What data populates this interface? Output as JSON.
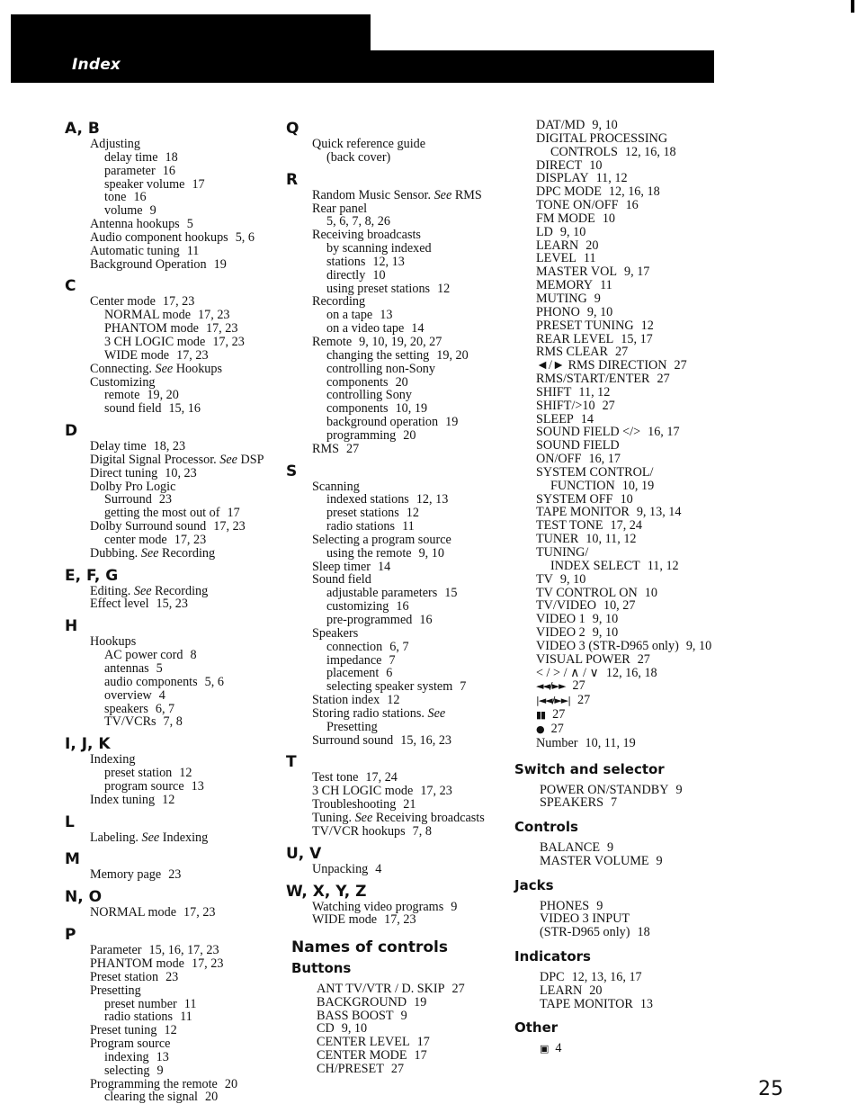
{
  "header": {
    "title": "Index"
  },
  "page_number": "25",
  "column1": [
    {
      "letter": "A, B",
      "entries": [
        {
          "level": 0,
          "text": "Adjusting",
          "pages": ""
        },
        {
          "level": 1,
          "text": "delay time",
          "pages": "18"
        },
        {
          "level": 1,
          "text": "parameter",
          "pages": "16"
        },
        {
          "level": 1,
          "text": "speaker volume",
          "pages": "17"
        },
        {
          "level": 1,
          "text": "tone",
          "pages": "16"
        },
        {
          "level": 1,
          "text": "volume",
          "pages": "9"
        },
        {
          "level": 0,
          "text": "Antenna hookups",
          "pages": "5"
        },
        {
          "level": 0,
          "text": "Audio component hookups",
          "pages": "5, 6"
        },
        {
          "level": 0,
          "text": "Automatic tuning",
          "pages": "11"
        },
        {
          "level": 0,
          "text": "Background Operation",
          "pages": "19"
        }
      ]
    },
    {
      "letter": "C",
      "entries": [
        {
          "level": 0,
          "text": "Center mode",
          "pages": "17, 23"
        },
        {
          "level": 1,
          "text": "NORMAL mode",
          "pages": "17, 23"
        },
        {
          "level": 1,
          "text": "PHANTOM mode",
          "pages": "17, 23"
        },
        {
          "level": 1,
          "text": "3 CH LOGIC mode",
          "pages": "17, 23"
        },
        {
          "level": 1,
          "text": "WIDE mode",
          "pages": "17, 23"
        },
        {
          "level": 0,
          "text": "Connecting.",
          "see": "See",
          "after": "Hookups",
          "pages": ""
        },
        {
          "level": 0,
          "text": "Customizing",
          "pages": ""
        },
        {
          "level": 1,
          "text": "remote",
          "pages": "19, 20"
        },
        {
          "level": 1,
          "text": "sound field",
          "pages": "15, 16"
        }
      ]
    },
    {
      "letter": "D",
      "entries": [
        {
          "level": 0,
          "text": "Delay time",
          "pages": "18, 23"
        },
        {
          "level": 0,
          "text": "Digital Signal Processor.",
          "see": "See",
          "after": "DSP",
          "pages": ""
        },
        {
          "level": 0,
          "text": "Direct tuning",
          "pages": "10, 23"
        },
        {
          "level": 0,
          "text": "Dolby Pro Logic",
          "pages": ""
        },
        {
          "level": 1,
          "text": "Surround",
          "pages": "23"
        },
        {
          "level": 1,
          "text": "getting the most out of",
          "pages": "17"
        },
        {
          "level": 0,
          "text": "Dolby Surround sound",
          "pages": "17, 23"
        },
        {
          "level": 1,
          "text": "center mode",
          "pages": "17, 23"
        },
        {
          "level": 0,
          "text": "Dubbing.",
          "see": "See",
          "after": "Recording",
          "pages": ""
        }
      ]
    },
    {
      "letter": "E, F, G",
      "entries": [
        {
          "level": 0,
          "text": "Editing.",
          "see": "See",
          "after": "Recording",
          "pages": ""
        },
        {
          "level": 0,
          "text": "Effect level",
          "pages": "15, 23"
        }
      ]
    },
    {
      "letter": "H",
      "entries": [
        {
          "level": 0,
          "text": "Hookups",
          "pages": ""
        },
        {
          "level": 1,
          "text": "AC power cord",
          "pages": "8"
        },
        {
          "level": 1,
          "text": "antennas",
          "pages": "5"
        },
        {
          "level": 1,
          "text": "audio components",
          "pages": "5, 6"
        },
        {
          "level": 1,
          "text": "overview",
          "pages": "4"
        },
        {
          "level": 1,
          "text": "speakers",
          "pages": "6, 7"
        },
        {
          "level": 1,
          "text": "TV/VCRs",
          "pages": "7, 8"
        }
      ]
    },
    {
      "letter": "I, J, K",
      "entries": [
        {
          "level": 0,
          "text": "Indexing",
          "pages": ""
        },
        {
          "level": 1,
          "text": "preset station",
          "pages": "12"
        },
        {
          "level": 1,
          "text": "program source",
          "pages": "13"
        },
        {
          "level": 0,
          "text": "Index tuning",
          "pages": "12"
        }
      ]
    },
    {
      "letter": "L",
      "entries": [
        {
          "level": 0,
          "text": "Labeling.",
          "see": "See",
          "after": "Indexing",
          "pages": ""
        }
      ]
    },
    {
      "letter": "M",
      "entries": [
        {
          "level": 0,
          "text": "Memory page",
          "pages": "23"
        }
      ]
    },
    {
      "letter": "N, O",
      "entries": [
        {
          "level": 0,
          "text": "NORMAL mode",
          "pages": "17, 23"
        }
      ]
    },
    {
      "letter": "P",
      "entries": [
        {
          "level": 0,
          "text": "Parameter",
          "pages": "15, 16, 17, 23"
        },
        {
          "level": 0,
          "text": "PHANTOM mode",
          "pages": "17, 23"
        },
        {
          "level": 0,
          "text": "Preset station",
          "pages": "23"
        },
        {
          "level": 0,
          "text": "Presetting",
          "pages": ""
        },
        {
          "level": 1,
          "text": "preset number",
          "pages": "11"
        },
        {
          "level": 1,
          "text": "radio stations",
          "pages": "11"
        },
        {
          "level": 0,
          "text": "Preset tuning",
          "pages": "12"
        },
        {
          "level": 0,
          "text": "Program source",
          "pages": ""
        },
        {
          "level": 1,
          "text": "indexing",
          "pages": "13"
        },
        {
          "level": 1,
          "text": "selecting",
          "pages": "9"
        },
        {
          "level": 0,
          "text": "Programming the remote",
          "pages": "20"
        },
        {
          "level": 1,
          "text": "clearing the signal",
          "pages": "20"
        }
      ]
    }
  ],
  "column2": [
    {
      "letter": "Q",
      "entries": [
        {
          "level": 0,
          "text": "Quick reference guide",
          "pages": ""
        },
        {
          "level": 1,
          "text": "(back cover)",
          "pages": ""
        }
      ]
    },
    {
      "letter": "R",
      "entries": [
        {
          "level": 0,
          "text": "Random Music Sensor.",
          "see": "See",
          "after": "RMS",
          "pages": ""
        },
        {
          "level": 0,
          "text": "Rear panel",
          "pages": ""
        },
        {
          "level": 1,
          "text": "5, 6, 7, 8, 26",
          "pages": ""
        },
        {
          "level": 0,
          "text": "Receiving broadcasts",
          "pages": ""
        },
        {
          "level": 1,
          "text": "by scanning indexed",
          "pages": ""
        },
        {
          "level": 1,
          "text": "stations",
          "pages": "12, 13"
        },
        {
          "level": 1,
          "text": "directly",
          "pages": "10"
        },
        {
          "level": 1,
          "text": "using preset stations",
          "pages": "12"
        },
        {
          "level": 0,
          "text": "Recording",
          "pages": ""
        },
        {
          "level": 1,
          "text": "on a tape",
          "pages": "13"
        },
        {
          "level": 1,
          "text": "on a video tape",
          "pages": "14"
        },
        {
          "level": 0,
          "text": "Remote",
          "pages": "9, 10, 19, 20, 27"
        },
        {
          "level": 1,
          "text": "changing the setting",
          "pages": "19, 20"
        },
        {
          "level": 1,
          "text": "controlling non-Sony",
          "pages": ""
        },
        {
          "level": 1,
          "text": "components",
          "pages": "20"
        },
        {
          "level": 1,
          "text": "controlling Sony",
          "pages": ""
        },
        {
          "level": 1,
          "text": "components",
          "pages": "10, 19"
        },
        {
          "level": 1,
          "text": "background operation",
          "pages": "19"
        },
        {
          "level": 1,
          "text": "programming",
          "pages": "20"
        },
        {
          "level": 0,
          "text": "RMS",
          "pages": "27"
        }
      ]
    },
    {
      "letter": "S",
      "entries": [
        {
          "level": 0,
          "text": "Scanning",
          "pages": ""
        },
        {
          "level": 1,
          "text": "indexed stations",
          "pages": "12, 13"
        },
        {
          "level": 1,
          "text": "preset stations",
          "pages": "12"
        },
        {
          "level": 1,
          "text": "radio stations",
          "pages": "11"
        },
        {
          "level": 0,
          "text": "Selecting a program source",
          "pages": ""
        },
        {
          "level": 1,
          "text": "using the remote",
          "pages": "9, 10"
        },
        {
          "level": 0,
          "text": "Sleep timer",
          "pages": "14"
        },
        {
          "level": 0,
          "text": "Sound field",
          "pages": ""
        },
        {
          "level": 1,
          "text": "adjustable parameters",
          "pages": "15"
        },
        {
          "level": 1,
          "text": "customizing",
          "pages": "16"
        },
        {
          "level": 1,
          "text": "pre-programmed",
          "pages": "16"
        },
        {
          "level": 0,
          "text": "Speakers",
          "pages": ""
        },
        {
          "level": 1,
          "text": "connection",
          "pages": "6, 7"
        },
        {
          "level": 1,
          "text": "impedance",
          "pages": "7"
        },
        {
          "level": 1,
          "text": "placement",
          "pages": "6"
        },
        {
          "level": 1,
          "text": "selecting speaker system",
          "pages": "7"
        },
        {
          "level": 0,
          "text": "Station index",
          "pages": "12"
        },
        {
          "level": 0,
          "text": "Storing radio stations.",
          "see": "See",
          "after": "",
          "pages": ""
        },
        {
          "level": 1,
          "text": "Presetting",
          "pages": ""
        },
        {
          "level": 0,
          "text": "Surround sound",
          "pages": "15, 16, 23"
        }
      ]
    },
    {
      "letter": "T",
      "entries": [
        {
          "level": 0,
          "text": "Test tone",
          "pages": "17, 24"
        },
        {
          "level": 0,
          "text": "3 CH LOGIC mode",
          "pages": "17, 23"
        },
        {
          "level": 0,
          "text": "Troubleshooting",
          "pages": "21"
        },
        {
          "level": 0,
          "text": "Tuning.",
          "see": "See",
          "after": "Receiving broadcasts",
          "pages": ""
        },
        {
          "level": 0,
          "text": "TV/VCR hookups",
          "pages": "7, 8"
        }
      ]
    },
    {
      "letter": "U, V",
      "entries": [
        {
          "level": 0,
          "text": "Unpacking",
          "pages": "4"
        }
      ]
    },
    {
      "letter": "W, X, Y, Z",
      "entries": [
        {
          "level": 0,
          "text": "Watching video programs",
          "pages": "9"
        },
        {
          "level": 0,
          "text": "WIDE mode",
          "pages": "17, 23"
        }
      ]
    }
  ],
  "names_of_controls": {
    "title": "Names of controls",
    "buttons_title": "Buttons",
    "buttons_col2": [
      {
        "level": 0,
        "text": "ANT TV/VTR / D. SKIP",
        "pages": "27"
      },
      {
        "level": 0,
        "text": "BACKGROUND",
        "pages": "19"
      },
      {
        "level": 0,
        "text": "BASS BOOST",
        "pages": "9"
      },
      {
        "level": 0,
        "text": "CD",
        "pages": "9, 10"
      },
      {
        "level": 0,
        "text": "CENTER LEVEL",
        "pages": "17"
      },
      {
        "level": 0,
        "text": "CENTER MODE",
        "pages": "17"
      },
      {
        "level": 0,
        "text": "CH/PRESET",
        "pages": "27"
      }
    ],
    "buttons_col3": [
      {
        "level": 0,
        "text": "DAT/MD",
        "pages": "9, 10"
      },
      {
        "level": 0,
        "text": "DIGITAL PROCESSING",
        "pages": ""
      },
      {
        "level": 1,
        "text": "CONTROLS",
        "pages": "12, 16, 18"
      },
      {
        "level": 0,
        "text": "DIRECT",
        "pages": "10"
      },
      {
        "level": 0,
        "text": "DISPLAY",
        "pages": "11, 12"
      },
      {
        "level": 0,
        "text": "DPC MODE",
        "pages": "12, 16, 18"
      },
      {
        "level": 0,
        "text": "TONE ON/OFF",
        "pages": "16"
      },
      {
        "level": 0,
        "text": "FM MODE",
        "pages": "10"
      },
      {
        "level": 0,
        "text": "LD",
        "pages": "9, 10"
      },
      {
        "level": 0,
        "text": "LEARN",
        "pages": "20"
      },
      {
        "level": 0,
        "text": "LEVEL",
        "pages": "11"
      },
      {
        "level": 0,
        "text": "MASTER VOL",
        "pages": "9, 17"
      },
      {
        "level": 0,
        "text": "MEMORY",
        "pages": "11"
      },
      {
        "level": 0,
        "text": "MUTING",
        "pages": "9"
      },
      {
        "level": 0,
        "text": "PHONO",
        "pages": "9, 10"
      },
      {
        "level": 0,
        "text": "PRESET TUNING",
        "pages": "12"
      },
      {
        "level": 0,
        "text": "REAR LEVEL",
        "pages": "15, 17"
      },
      {
        "level": 0,
        "text": "RMS CLEAR",
        "pages": "27"
      },
      {
        "level": 0,
        "text": "◄/► RMS DIRECTION",
        "pages": "27"
      },
      {
        "level": 0,
        "text": "RMS/START/ENTER",
        "pages": "27"
      },
      {
        "level": 0,
        "text": "SHIFT",
        "pages": "11, 12"
      },
      {
        "level": 0,
        "text": "SHIFT/>10",
        "pages": "27"
      },
      {
        "level": 0,
        "text": "SLEEP",
        "pages": "14"
      },
      {
        "level": 0,
        "text": "SOUND FIELD </>",
        "pages": "16, 17"
      },
      {
        "level": 0,
        "text": "SOUND FIELD",
        "pages": ""
      },
      {
        "level": 0,
        "text": "ON/OFF",
        "pages": "16, 17"
      },
      {
        "level": 0,
        "text": "SYSTEM CONTROL/",
        "pages": ""
      },
      {
        "level": 1,
        "text": "FUNCTION",
        "pages": "10, 19"
      },
      {
        "level": 0,
        "text": "SYSTEM OFF",
        "pages": "10"
      },
      {
        "level": 0,
        "text": "TAPE MONITOR",
        "pages": "9, 13, 14"
      },
      {
        "level": 0,
        "text": "TEST TONE",
        "pages": "17, 24"
      },
      {
        "level": 0,
        "text": "TUNER",
        "pages": "10, 11, 12"
      },
      {
        "level": 0,
        "text": "TUNING/",
        "pages": ""
      },
      {
        "level": 1,
        "text": "INDEX SELECT",
        "pages": "11, 12"
      },
      {
        "level": 0,
        "text": "TV",
        "pages": "9, 10"
      },
      {
        "level": 0,
        "text": "TV CONTROL ON",
        "pages": "10"
      },
      {
        "level": 0,
        "text": "TV/VIDEO",
        "pages": "10, 27"
      },
      {
        "level": 0,
        "text": "VIDEO 1",
        "pages": "9, 10"
      },
      {
        "level": 0,
        "text": "VIDEO 2",
        "pages": "9, 10"
      },
      {
        "level": 0,
        "text": "VIDEO 3 (STR-D965 only)",
        "pages": "9, 10"
      },
      {
        "level": 0,
        "text": "VISUAL POWER",
        "pages": "27"
      },
      {
        "level": 0,
        "text": "< / > / ∧ / ∨",
        "pages": "12, 16, 18"
      },
      {
        "level": 0,
        "text": "◄◄/►►",
        "pages": "27",
        "icon": "rewind-fastforward-icon"
      },
      {
        "level": 0,
        "text": "|◄◄/►►|",
        "pages": "27",
        "icon": "skip-back-forward-icon"
      },
      {
        "level": 0,
        "text": "▮▮",
        "pages": "27",
        "icon": "pause-icon"
      },
      {
        "level": 0,
        "text": "●",
        "pages": "27",
        "icon": "record-icon"
      },
      {
        "level": 0,
        "text": "Number",
        "pages": "10, 11, 19"
      }
    ],
    "sections": [
      {
        "title": "Switch and selector",
        "entries": [
          {
            "level": 0,
            "text": "POWER ON/STANDBY",
            "pages": "9"
          },
          {
            "level": 0,
            "text": "SPEAKERS",
            "pages": "7"
          }
        ]
      },
      {
        "title": "Controls",
        "entries": [
          {
            "level": 0,
            "text": "BALANCE",
            "pages": "9"
          },
          {
            "level": 0,
            "text": "MASTER VOLUME",
            "pages": "9"
          }
        ]
      },
      {
        "title": "Jacks",
        "entries": [
          {
            "level": 0,
            "text": "PHONES",
            "pages": "9"
          },
          {
            "level": 0,
            "text": "VIDEO 3 INPUT",
            "pages": ""
          },
          {
            "level": 0,
            "text": "(STR-D965 only)",
            "pages": "18"
          }
        ]
      },
      {
        "title": "Indicators",
        "entries": [
          {
            "level": 0,
            "text": "DPC",
            "pages": "12, 13, 16, 17"
          },
          {
            "level": 0,
            "text": "LEARN",
            "pages": "20"
          },
          {
            "level": 0,
            "text": "TAPE MONITOR",
            "pages": "13"
          }
        ]
      },
      {
        "title": "Other",
        "entries": [
          {
            "level": 0,
            "text": "▣",
            "pages": "4",
            "icon": "panel-symbol-icon"
          }
        ]
      }
    ]
  }
}
